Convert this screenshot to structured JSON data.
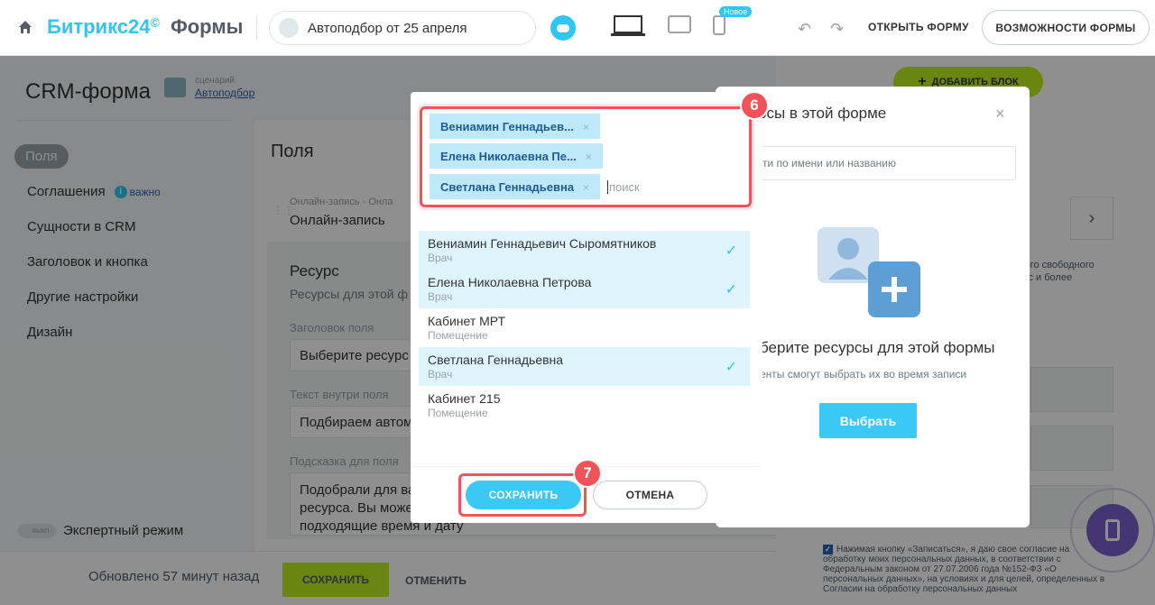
{
  "header": {
    "brand_name": "Битрикс24",
    "brand_clock": "©",
    "brand_suffix": "Формы",
    "scenario_value": "Автоподбор от 25 апреля",
    "new_badge": "Новое",
    "open_form": "ОТКРЫТЬ ФОРМУ",
    "features": "ВОЗМОЖНОСТИ ФОРМЫ"
  },
  "left": {
    "title": "CRM-форма",
    "scenario_label": "сценарий",
    "scenario_link": "Автоподбор",
    "nav": [
      "Поля",
      "Соглашения",
      "Сущности в CRM",
      "Заголовок и кнопка",
      "Другие настройки",
      "Дизайн"
    ],
    "important": "важно",
    "expert_toggle": "выкл",
    "expert_label": "Экспертный режим"
  },
  "card": {
    "title": "Поля",
    "online_small": "Онлайн-запись · Онла",
    "online": "Онлайн-запись",
    "resource_title": "Ресурс",
    "resource_sub": "Ресурсы для этой ф",
    "header_label": "Заголовок поля",
    "header_value": "Выберите ресурс",
    "inner_label": "Текст внутри поля",
    "inner_value": "Подбираем автом",
    "hint_label": "Подсказка для поля",
    "hint_l1": "Подобрали для ва",
    "hint_l2": "ресурса. Вы може",
    "hint_l3": "подходящие время и дату"
  },
  "footer": {
    "updated": "Обновлено 57 минут назад",
    "save": "СОХРАНИТЬ",
    "cancel": "ОТМЕНИТЬ"
  },
  "right": {
    "add_block": "ДОБАВИТЬ БЛОК",
    "desc_l1": "мого свободного",
    "desc_l2": "урс и более",
    "consent": "Нажимая кнопку «Записаться», я даю свое согласие на обработку моих персональных данных, в соответствии с Федеральным законом от 27.07.2006 года №152-ФЗ «О персональных данных», на условиях и для целей, определенных в Согласии на обработку персональных данных"
  },
  "bg_dialog": {
    "title": "рсы в этой форме",
    "search_placeholder": "ти по имени или названию",
    "pick_title": "берите ресурсы для этой формы",
    "pick_note": "енты смогут выбрать их во время записи",
    "choose_button": "Выбрать"
  },
  "modal": {
    "tags": [
      "Вениамин Геннадьев...",
      "Елена Николаевна Пе...",
      "Светлана Геннадьевна"
    ],
    "tag_remove": "×",
    "search_placeholder": "поиск",
    "items": [
      {
        "name": "Вениамин Геннадьевич Сыромятников",
        "role": "Врач",
        "selected": true
      },
      {
        "name": "Елена Николаевна Петрова",
        "role": "Врач",
        "selected": true
      },
      {
        "name": "Кабинет МРТ",
        "role": "Помещение",
        "selected": false
      },
      {
        "name": "Светлана Геннадьевна",
        "role": "Врач",
        "selected": true
      },
      {
        "name": "Кабинет 215",
        "role": "Помещение",
        "selected": false
      }
    ],
    "check": "✓",
    "save": "СОХРАНИТЬ",
    "cancel": "ОТМЕНА"
  },
  "steps": {
    "tags": "6",
    "save": "7"
  },
  "colors": {
    "accent": "#2fc6f6",
    "step": "#f2535b",
    "save_green": "#bbed21"
  }
}
